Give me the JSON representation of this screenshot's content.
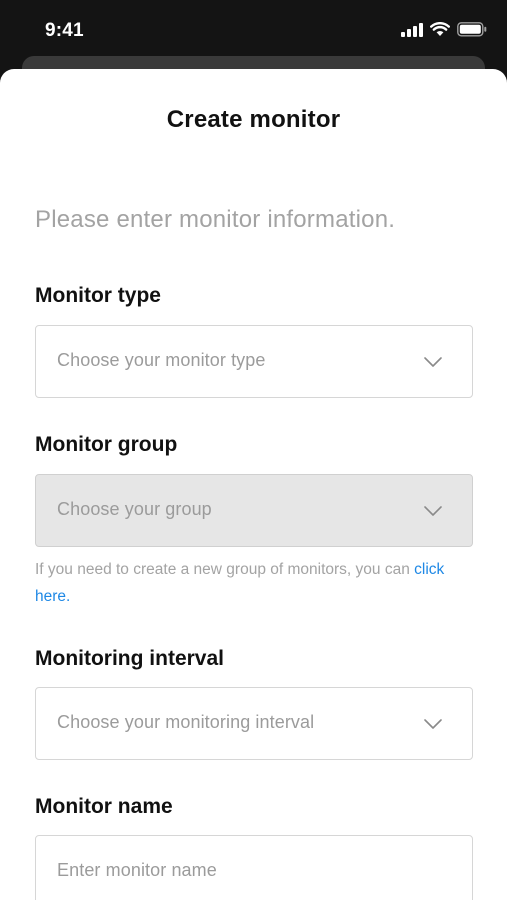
{
  "status_bar": {
    "time": "9:41",
    "icons": [
      "signal-icon",
      "wifi-icon",
      "battery-icon"
    ]
  },
  "sheet": {
    "title": "Create monitor",
    "subtitle": "Please enter monitor information."
  },
  "fields": {
    "monitor_type": {
      "label": "Monitor type",
      "placeholder": "Choose your monitor type",
      "icon": "chevron-down-icon"
    },
    "monitor_group": {
      "label": "Monitor group",
      "placeholder": "Choose your group",
      "icon": "chevron-down-icon",
      "help_text": "If you need to create a new group of monitors, you can ",
      "help_link": "click here",
      "help_end": "."
    },
    "monitoring_interval": {
      "label": "Monitoring interval",
      "placeholder": "Choose your monitoring interval",
      "icon": "chevron-down-icon"
    },
    "monitor_name": {
      "label": "Monitor name",
      "placeholder": "Enter monitor name"
    }
  },
  "colors": {
    "link": "#1e88e5",
    "placeholder": "#9b9b9b",
    "disabled_bg": "#e6e6e6"
  }
}
